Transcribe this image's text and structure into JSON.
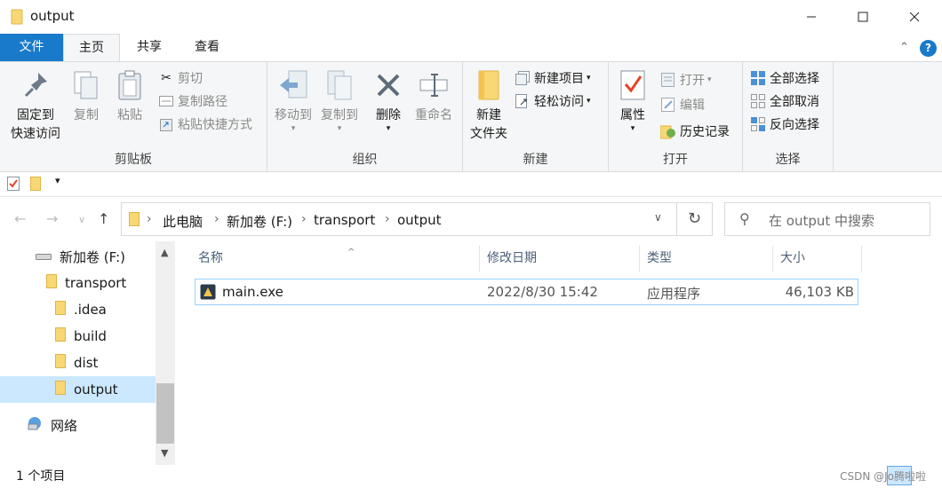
{
  "window": {
    "title": "output"
  },
  "tabs": {
    "file": "文件",
    "home": "主页",
    "share": "共享",
    "view": "查看"
  },
  "ribbon": {
    "clipboard": {
      "label": "剪贴板",
      "pin_line1": "固定到",
      "pin_line2": "快速访问",
      "copy": "复制",
      "paste": "粘贴",
      "cut": "剪切",
      "copy_path": "复制路径",
      "paste_shortcut": "粘贴快捷方式"
    },
    "organize": {
      "label": "组织",
      "move_to": "移动到",
      "copy_to": "复制到",
      "delete": "删除",
      "rename": "重命名"
    },
    "new": {
      "label": "新建",
      "folder_line1": "新建",
      "folder_line2": "文件夹",
      "new_item": "新建项目",
      "easy_access": "轻松访问"
    },
    "open": {
      "label": "打开",
      "properties": "属性",
      "open": "打开",
      "edit": "编辑",
      "history": "历史记录"
    },
    "select": {
      "label": "选择",
      "select_all": "全部选择",
      "select_none": "全部取消",
      "invert": "反向选择"
    }
  },
  "address": {
    "crumbs": [
      "此电脑",
      "新加卷 (F:)",
      "transport",
      "output"
    ]
  },
  "search": {
    "placeholder": "在 output 中搜索"
  },
  "tree": {
    "items": [
      "新加卷 (F:)",
      "transport",
      ".idea",
      "build",
      "dist",
      "output",
      "网络"
    ]
  },
  "columns": {
    "name": "名称",
    "modified": "修改日期",
    "type": "类型",
    "size": "大小"
  },
  "files": [
    {
      "name": "main.exe",
      "modified": "2022/8/30 15:42",
      "type": "应用程序",
      "size": "46,103 KB"
    }
  ],
  "status": {
    "count": "1 个项目",
    "watermark": "CSDN @Jo腾啦啦"
  },
  "colors": {
    "accent": "#1979ca",
    "ribbon_bg": "#f5f6f7",
    "selection": "#cce8ff",
    "folder": "#f8d775"
  }
}
